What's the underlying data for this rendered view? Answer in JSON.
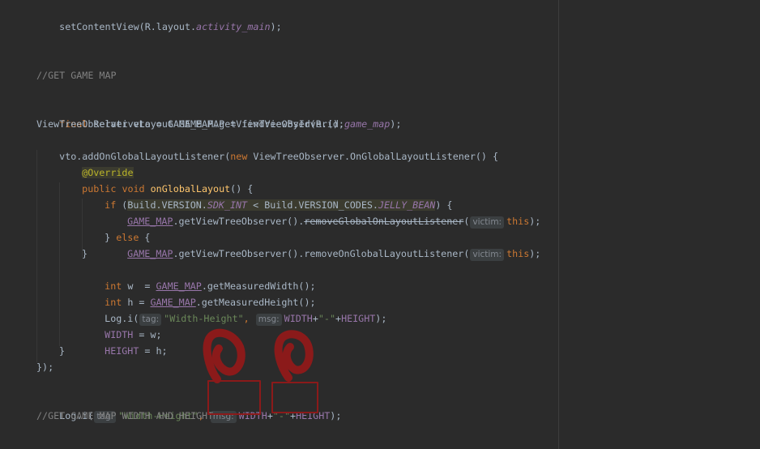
{
  "code": {
    "l_setcontent": {
      "head": "setContentView(R.layout.",
      "tail": "activity_main",
      "close": ");"
    },
    "c_getmap": "//GET GAME MAP",
    "l_final": {
      "kw": "final",
      "mid": " RelativeLayout GAME_MAP = findViewById(R.id.",
      "id": "game_map",
      "close": ");"
    },
    "l_vto": "ViewTreeObserver vto = GAME_MAP.getViewTreeObserver();",
    "l_addlistener": {
      "head": "vto.addOnGlobalLayoutListener(",
      "kw": "new",
      "tail": " ViewTreeObserver.OnGlobalLayoutListener() {"
    },
    "l_override": "@Override",
    "l_ongl": {
      "kw1": "public",
      "kw2": "void",
      "fn": "onGlobalLayout",
      "tail": "() {"
    },
    "l_if": {
      "kw": "if",
      "open": " (",
      "build": "Build.VERSION.",
      "sdk": "SDK_INT",
      "lt": " < Build.VERSION_CODES.",
      "jb": "JELLY_BEAN",
      "close": ") {"
    },
    "l_remove_old": {
      "gm": "GAME_MAP",
      "mid": ".getViewTreeObserver().",
      "method": "removeGlobalOnLayoutListener",
      "open": "(",
      "hint": "victim:",
      "this": "this",
      "close": ");"
    },
    "l_else": {
      "close": "} ",
      "kw": "else",
      "open": " {"
    },
    "l_remove_new": {
      "gm": "GAME_MAP",
      "mid": ".getViewTreeObserver().removeOnGlobalLayoutListener(",
      "hint": "victim:",
      "this": "this",
      "close": ");"
    },
    "l_brace": "}",
    "l_int_w": {
      "kw": "int",
      "mid": " w  = ",
      "gm": "GAME_MAP",
      "tail": ".getMeasuredWidth();"
    },
    "l_int_h": {
      "kw": "int",
      "mid": " h = ",
      "gm": "GAME_MAP",
      "tail": ".getMeasuredHeight();"
    },
    "l_log_inner": {
      "head": "Log.i(",
      "tag_hint": "tag:",
      "tag_val": "\"Width-Height\"",
      "comma": ", ",
      "msg_hint": "msg:",
      "width": "WIDTH",
      "plus1": "+",
      "dash": "\"-\"",
      "plus2": "+",
      "height": "HEIGHT",
      "close": ");"
    },
    "l_width_assign": {
      "field": "WIDTH",
      "tail": " = w;"
    },
    "l_height_assign": {
      "field": "HEIGHT",
      "tail": " = h;"
    },
    "l_close_listener": "});",
    "l_log_outer": {
      "head": "Log.i(",
      "tag_hint": "tag:",
      "tag_val": "\"Width-Height\"",
      "comma": ", ",
      "msg_hint": "msg:",
      "width": "WIDTH",
      "plus1": "+",
      "dash": "\"-\"",
      "plus2": "+",
      "height": "HEIGHT",
      "close": ");"
    },
    "c_getwidthheight": "//GET GAME MAP WIDTH AND HEIGHT"
  },
  "colors": {
    "background": "#2b2b2b",
    "keyword": "#cc7832",
    "method_decl": "#ffc66d",
    "annotation": "#bbb529",
    "comment": "#808080",
    "string": "#6a8759",
    "field": "#9876aa",
    "default_text": "#a9b7c6",
    "annotation_marker": "#8b1a1a"
  }
}
